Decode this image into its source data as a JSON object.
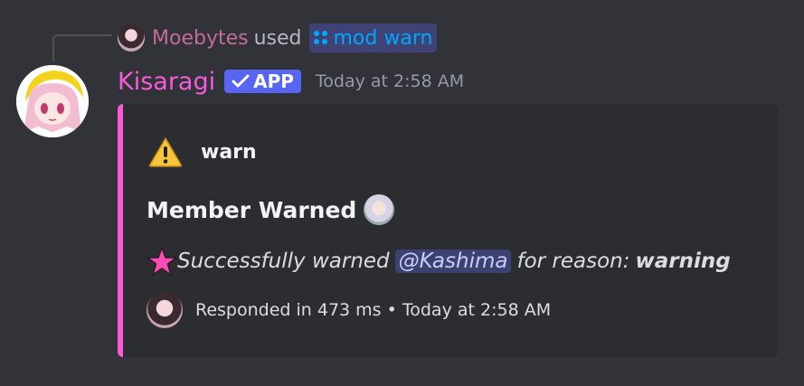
{
  "reply": {
    "user": "Moebytes",
    "used": "used",
    "command": "mod warn"
  },
  "message": {
    "username": "Kisaragi",
    "badge": "APP",
    "timestamp": "Today at 2:58 AM"
  },
  "embed": {
    "accent_color": "#f75bd7",
    "author": "warn",
    "title": "Member Warned",
    "description_prefix": "Successfully warned",
    "mention": "@Kashima",
    "description_middle": "for reason:",
    "reason": "warning",
    "footer": "Responded in 473 ms • Today at 2:58 AM"
  }
}
